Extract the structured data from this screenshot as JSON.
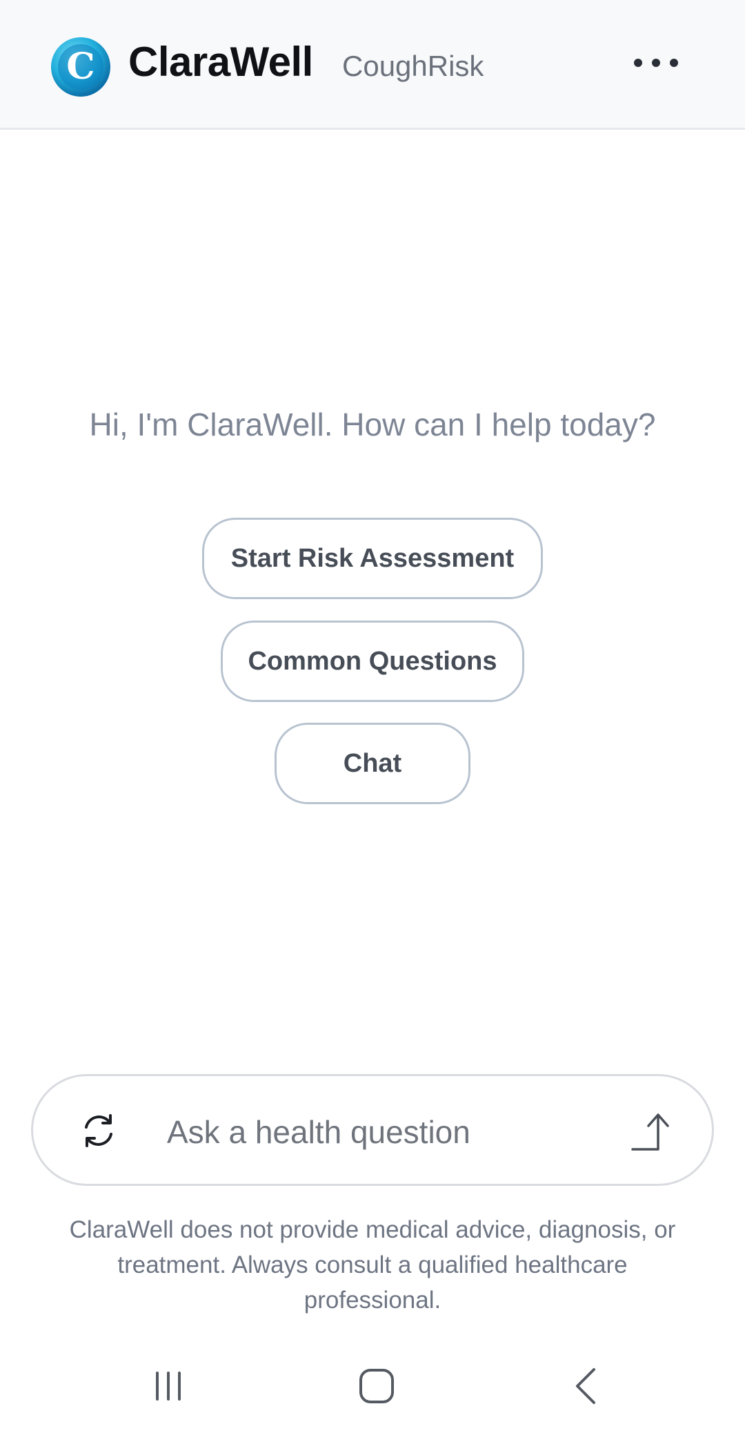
{
  "header": {
    "brand": "ClaraWell",
    "subtitle": "CoughRisk",
    "logo_letter": "C"
  },
  "main": {
    "greeting": "Hi, I'm ClaraWell. How can I help today?",
    "actions": [
      {
        "label": "Start Risk Assessment"
      },
      {
        "label": "Common Questions"
      },
      {
        "label": "Chat"
      }
    ]
  },
  "composer": {
    "placeholder": "Ask a health question",
    "value": ""
  },
  "disclaimer": "ClaraWell does not provide medical advice, diagnosis, or treatment. Always consult a qualified healthcare professional.",
  "icons": {
    "logo": "clarawell-logo-icon",
    "menu": "more-options-icon",
    "refresh": "refresh-icon",
    "send": "send-arrow-icon",
    "recents": "recents-icon",
    "home": "home-icon",
    "back": "back-icon"
  },
  "colors": {
    "brand_text": "#0f1115",
    "logo_blue": "#1ea7d8",
    "button_border": "#b8c3d0",
    "muted_text": "#7d8594"
  }
}
